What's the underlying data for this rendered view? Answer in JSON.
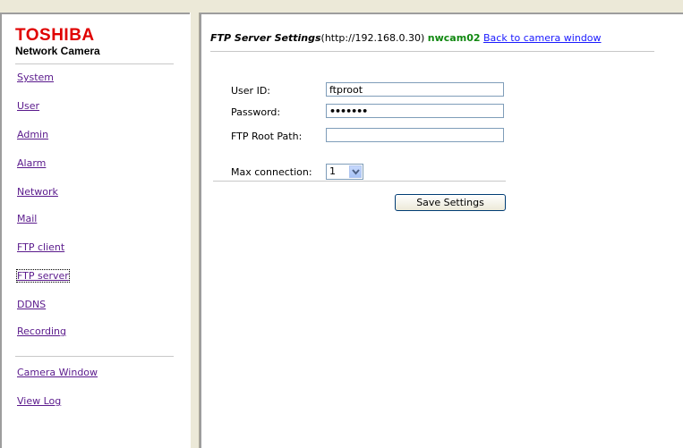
{
  "brand": {
    "name": "TOSHIBA",
    "product": "Network Camera",
    "brand_color": "#e00000"
  },
  "nav": {
    "items": [
      {
        "label": "System"
      },
      {
        "label": "User"
      },
      {
        "label": "Admin"
      },
      {
        "label": "Alarm"
      },
      {
        "label": "Network"
      },
      {
        "label": "Mail"
      },
      {
        "label": "FTP client"
      },
      {
        "label": "FTP server"
      },
      {
        "label": "DDNS"
      },
      {
        "label": "Recording"
      }
    ],
    "focused_item": "FTP server",
    "secondary": [
      {
        "label": "Camera Window"
      },
      {
        "label": "View Log"
      }
    ],
    "link_color": "#5a1a8c"
  },
  "header": {
    "title": "FTP Server Settings",
    "address": "(http://192.168.0.30)",
    "camera_name": "nwcam02",
    "back_link": "Back to camera window",
    "camera_name_color": "#108810",
    "back_link_color": "#1a1aff"
  },
  "form": {
    "user_id": {
      "label": "User ID:",
      "value": "ftproot"
    },
    "password": {
      "label": "Password:",
      "value": "•••••••"
    },
    "root_path": {
      "label": "FTP Root Path:",
      "value": ""
    },
    "max_connection": {
      "label": "Max connection:",
      "value": "1"
    },
    "save_button": "Save Settings"
  },
  "icons": {
    "dropdown": "chevron-down-icon"
  }
}
